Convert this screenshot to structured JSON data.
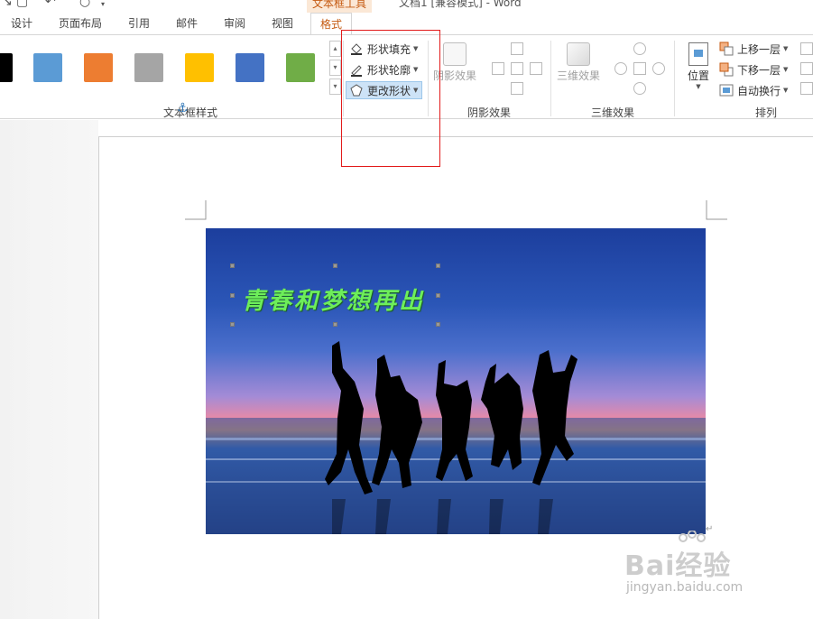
{
  "title_bar": {
    "contextual_tab": "文本框工具",
    "window_title": "文档1 [兼容模式] - Word"
  },
  "tabs": [
    {
      "label": "设计"
    },
    {
      "label": "页面布局"
    },
    {
      "label": "引用"
    },
    {
      "label": "邮件"
    },
    {
      "label": "审阅"
    },
    {
      "label": "视图"
    },
    {
      "label": "格式",
      "active": true
    }
  ],
  "ribbon": {
    "textbox_styles": {
      "label": "文本框样式",
      "swatch_colors": [
        "#000000",
        "#5b9bd5",
        "#ed7d31",
        "#a5a5a5",
        "#ffc000",
        "#4472c4",
        "#70ad47"
      ]
    },
    "shape_commands": {
      "fill": "形状填充",
      "outline": "形状轮廓",
      "change": "更改形状"
    },
    "shadow": {
      "button": "阴影效果",
      "label": "阴影效果"
    },
    "threed": {
      "button": "三维效果",
      "label": "三维效果"
    },
    "arrange": {
      "position": "位置",
      "bring_forward": "上移一层",
      "send_backward": "下移一层",
      "wrap_text": "自动换行",
      "label": "排列"
    }
  },
  "document": {
    "caption_text": "青春和梦想再出"
  },
  "watermark": {
    "brand": "Bai经验",
    "url": "jingyan.baidu.com"
  },
  "colors": {
    "accent_orange": "#c55a11",
    "highlight_red": "#e21b1b",
    "caption_green": "#6dee5a",
    "selected_cmd_bg": "#cde3f7"
  }
}
